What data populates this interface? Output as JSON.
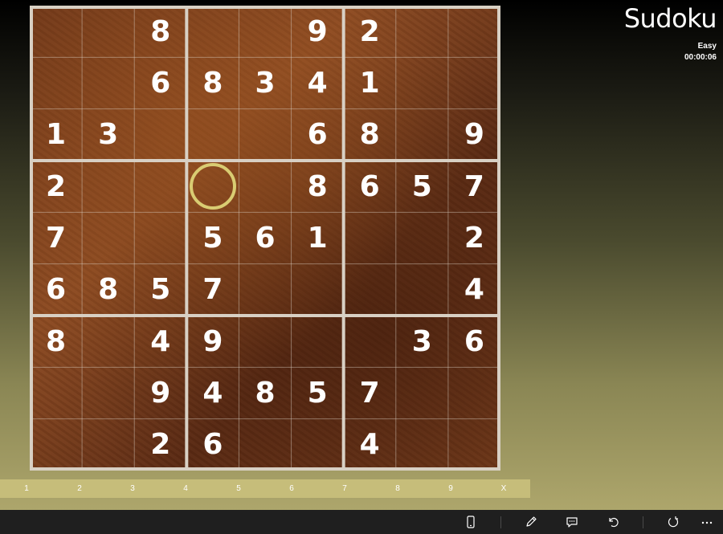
{
  "app": {
    "title": "Sudoku"
  },
  "status": {
    "difficulty": "Easy",
    "timer": "00:00:06"
  },
  "board": {
    "size": 9,
    "selected": {
      "row": 3,
      "col": 3
    },
    "grid": [
      [
        "",
        "",
        "8",
        "",
        "",
        "9",
        "2",
        "",
        ""
      ],
      [
        "",
        "",
        "6",
        "8",
        "3",
        "4",
        "1",
        "",
        ""
      ],
      [
        "1",
        "3",
        "",
        "",
        "",
        "6",
        "8",
        "",
        "9"
      ],
      [
        "2",
        "",
        "",
        "",
        "",
        "8",
        "6",
        "5",
        "7"
      ],
      [
        "7",
        "",
        "",
        "5",
        "6",
        "1",
        "",
        "",
        "2"
      ],
      [
        "6",
        "8",
        "5",
        "7",
        "",
        "",
        "",
        "",
        "4"
      ],
      [
        "8",
        "",
        "4",
        "9",
        "",
        "",
        "",
        "3",
        "6"
      ],
      [
        "",
        "",
        "9",
        "4",
        "8",
        "5",
        "7",
        "",
        ""
      ],
      [
        "",
        "",
        "2",
        "6",
        "",
        "",
        "4",
        "",
        ""
      ]
    ]
  },
  "numpad": {
    "keys": [
      "1",
      "2",
      "3",
      "4",
      "5",
      "6",
      "7",
      "8",
      "9",
      "X"
    ]
  },
  "appbar": {
    "buttons": [
      {
        "name": "phone-icon-button",
        "icon": "phone-icon"
      },
      {
        "name": "pencil-icon-button",
        "icon": "pencil-icon"
      },
      {
        "name": "hint-icon-button",
        "icon": "chat-icon"
      },
      {
        "name": "undo-icon-button",
        "icon": "undo-icon"
      },
      {
        "name": "restart-icon-button",
        "icon": "refresh-icon"
      },
      {
        "name": "more-icon-button",
        "icon": "more-icon"
      }
    ]
  },
  "colors": {
    "selection_ring": "#d9cc72",
    "numpad_bg": "#c6bd7a",
    "appbar_bg": "#1f1f1f",
    "digit": "#ffffff"
  }
}
